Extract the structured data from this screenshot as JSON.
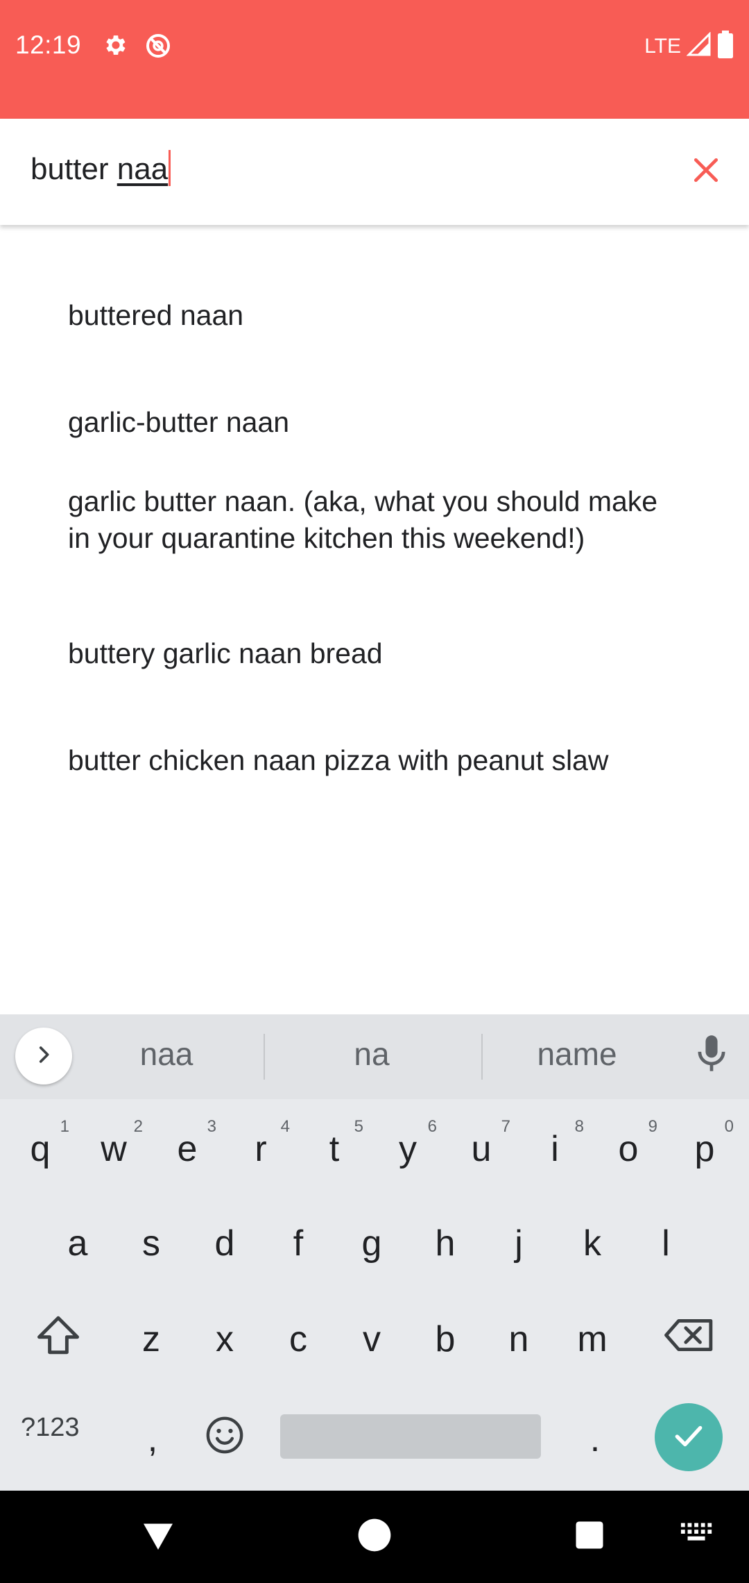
{
  "status_bar": {
    "time": "12:19",
    "network": "LTE",
    "icons": [
      "gear-icon",
      "no-location-icon",
      "signal-icon",
      "battery-icon"
    ],
    "background": "#F85C55"
  },
  "search": {
    "text_prefix": "butter ",
    "text_composing": "naa",
    "clear_icon": "close-icon",
    "accent": "#F85C55"
  },
  "suggestions": [
    "buttered naan",
    "garlic-butter naan",
    "garlic butter naan. (aka, what you should make in your quarantine kitchen this weekend!)",
    "buttery garlic naan bread",
    "butter chicken naan pizza with peanut slaw"
  ],
  "keyboard": {
    "word_suggestions": [
      "naa",
      "na",
      "name"
    ],
    "row1": [
      {
        "key": "q",
        "hint": "1"
      },
      {
        "key": "w",
        "hint": "2"
      },
      {
        "key": "e",
        "hint": "3"
      },
      {
        "key": "r",
        "hint": "4"
      },
      {
        "key": "t",
        "hint": "5"
      },
      {
        "key": "y",
        "hint": "6"
      },
      {
        "key": "u",
        "hint": "7"
      },
      {
        "key": "i",
        "hint": "8"
      },
      {
        "key": "o",
        "hint": "9"
      },
      {
        "key": "p",
        "hint": "0"
      }
    ],
    "row2": [
      "a",
      "s",
      "d",
      "f",
      "g",
      "h",
      "j",
      "k",
      "l"
    ],
    "row3": [
      "z",
      "x",
      "c",
      "v",
      "b",
      "n",
      "m"
    ],
    "symbols_label": "?123",
    "comma": ",",
    "period": ".",
    "enter_color": "#4DB6AC"
  },
  "nav_bar": {
    "buttons": [
      "back-icon",
      "home-icon",
      "recents-icon",
      "keyboard-switch-icon"
    ]
  }
}
